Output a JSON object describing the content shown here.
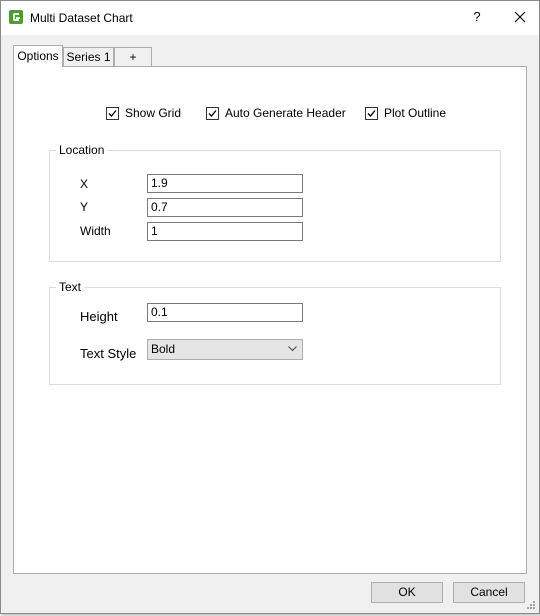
{
  "window": {
    "title": "Multi Dataset Chart",
    "help_label": "?"
  },
  "tabs": [
    {
      "label": "Options",
      "active": true
    },
    {
      "label": "Series 1",
      "active": false
    },
    {
      "label": "+",
      "active": false
    }
  ],
  "options": {
    "show_grid": {
      "label": "Show Grid",
      "checked": true
    },
    "auto_generate_header": {
      "label": "Auto Generate Header",
      "checked": true
    },
    "plot_outline": {
      "label": "Plot Outline",
      "checked": true
    }
  },
  "location": {
    "legend": "Location",
    "x_label": "X",
    "x_value": "1.9",
    "y_label": "Y",
    "y_value": "0.7",
    "width_label": "Width",
    "width_value": "1"
  },
  "text": {
    "legend": "Text",
    "height_label": "Height",
    "height_value": "0.1",
    "style_label": "Text Style",
    "style_value": "Bold"
  },
  "buttons": {
    "ok": "OK",
    "cancel": "Cancel"
  },
  "colors": {
    "app_icon": "#4aa02c",
    "dialog_bg": "#f0f0f0",
    "panel_bg": "#ffffff"
  },
  "icons": {
    "app": "app-logo-icon",
    "help": "help-icon",
    "close": "close-icon",
    "check": "check-icon",
    "dropdown": "chevron-down-icon"
  }
}
